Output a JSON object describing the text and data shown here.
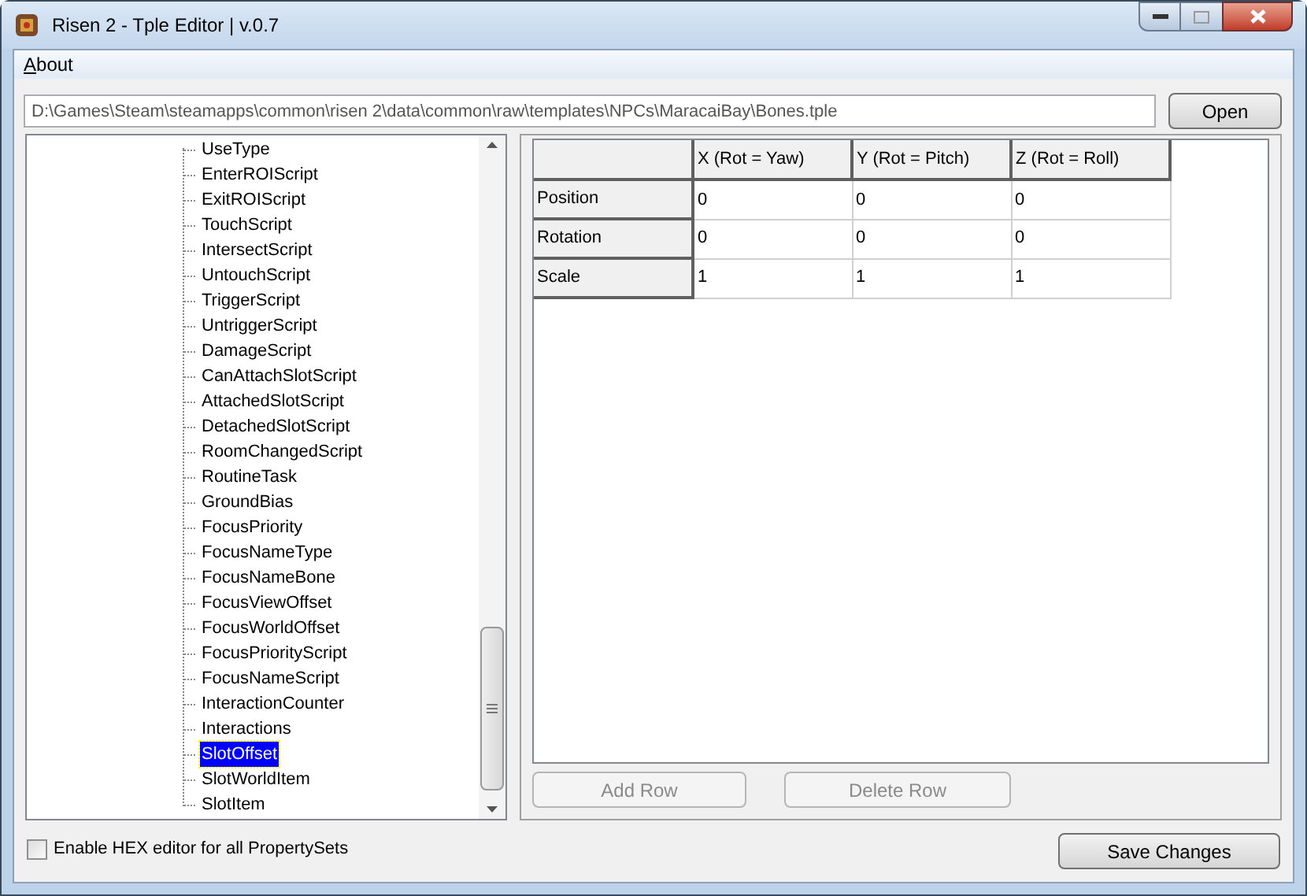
{
  "window": {
    "title": "Risen 2 - Tple Editor | v.0.7"
  },
  "menu": [
    {
      "label": "About",
      "mnemonic_underlined": true
    }
  ],
  "path_field": {
    "value": "D:\\Games\\Steam\\steamapps\\common\\risen 2\\data\\common\\raw\\templates\\NPCs\\MaracaiBay\\Bones.tple"
  },
  "open_button": {
    "label": "Open"
  },
  "tree": {
    "items": [
      {
        "label": "UseType",
        "selected": false
      },
      {
        "label": "EnterROIScript",
        "selected": false
      },
      {
        "label": "ExitROIScript",
        "selected": false
      },
      {
        "label": "TouchScript",
        "selected": false
      },
      {
        "label": "IntersectScript",
        "selected": false
      },
      {
        "label": "UntouchScript",
        "selected": false
      },
      {
        "label": "TriggerScript",
        "selected": false
      },
      {
        "label": "UntriggerScript",
        "selected": false
      },
      {
        "label": "DamageScript",
        "selected": false
      },
      {
        "label": "CanAttachSlotScript",
        "selected": false
      },
      {
        "label": "AttachedSlotScript",
        "selected": false
      },
      {
        "label": "DetachedSlotScript",
        "selected": false
      },
      {
        "label": "RoomChangedScript",
        "selected": false
      },
      {
        "label": "RoutineTask",
        "selected": false
      },
      {
        "label": "GroundBias",
        "selected": false
      },
      {
        "label": "FocusPriority",
        "selected": false
      },
      {
        "label": "FocusNameType",
        "selected": false
      },
      {
        "label": "FocusNameBone",
        "selected": false
      },
      {
        "label": "FocusViewOffset",
        "selected": false
      },
      {
        "label": "FocusWorldOffset",
        "selected": false
      },
      {
        "label": "FocusPriorityScript",
        "selected": false
      },
      {
        "label": "FocusNameScript",
        "selected": false
      },
      {
        "label": "InteractionCounter",
        "selected": false
      },
      {
        "label": "Interactions",
        "selected": false
      },
      {
        "label": "SlotOffset",
        "selected": true
      },
      {
        "label": "SlotWorldItem",
        "selected": false
      },
      {
        "label": "SlotItem",
        "selected": false
      }
    ]
  },
  "table": {
    "columns": [
      "X (Rot = Yaw)",
      "Y (Rot = Pitch)",
      "Z (Rot = Roll)"
    ],
    "rows": [
      {
        "header": "Position",
        "cells": [
          "0",
          "0",
          "0"
        ]
      },
      {
        "header": "Rotation",
        "cells": [
          "0",
          "0",
          "0"
        ]
      },
      {
        "header": "Scale",
        "cells": [
          "1",
          "1",
          "1"
        ]
      }
    ]
  },
  "table_buttons": [
    {
      "label": "Add Row",
      "disabled": true
    },
    {
      "label": "Delete Row",
      "disabled": true
    }
  ],
  "hex_checkbox": {
    "label": "Enable HEX editor for all PropertySets",
    "checked": false
  },
  "save_button": {
    "label": "Save Changes"
  }
}
